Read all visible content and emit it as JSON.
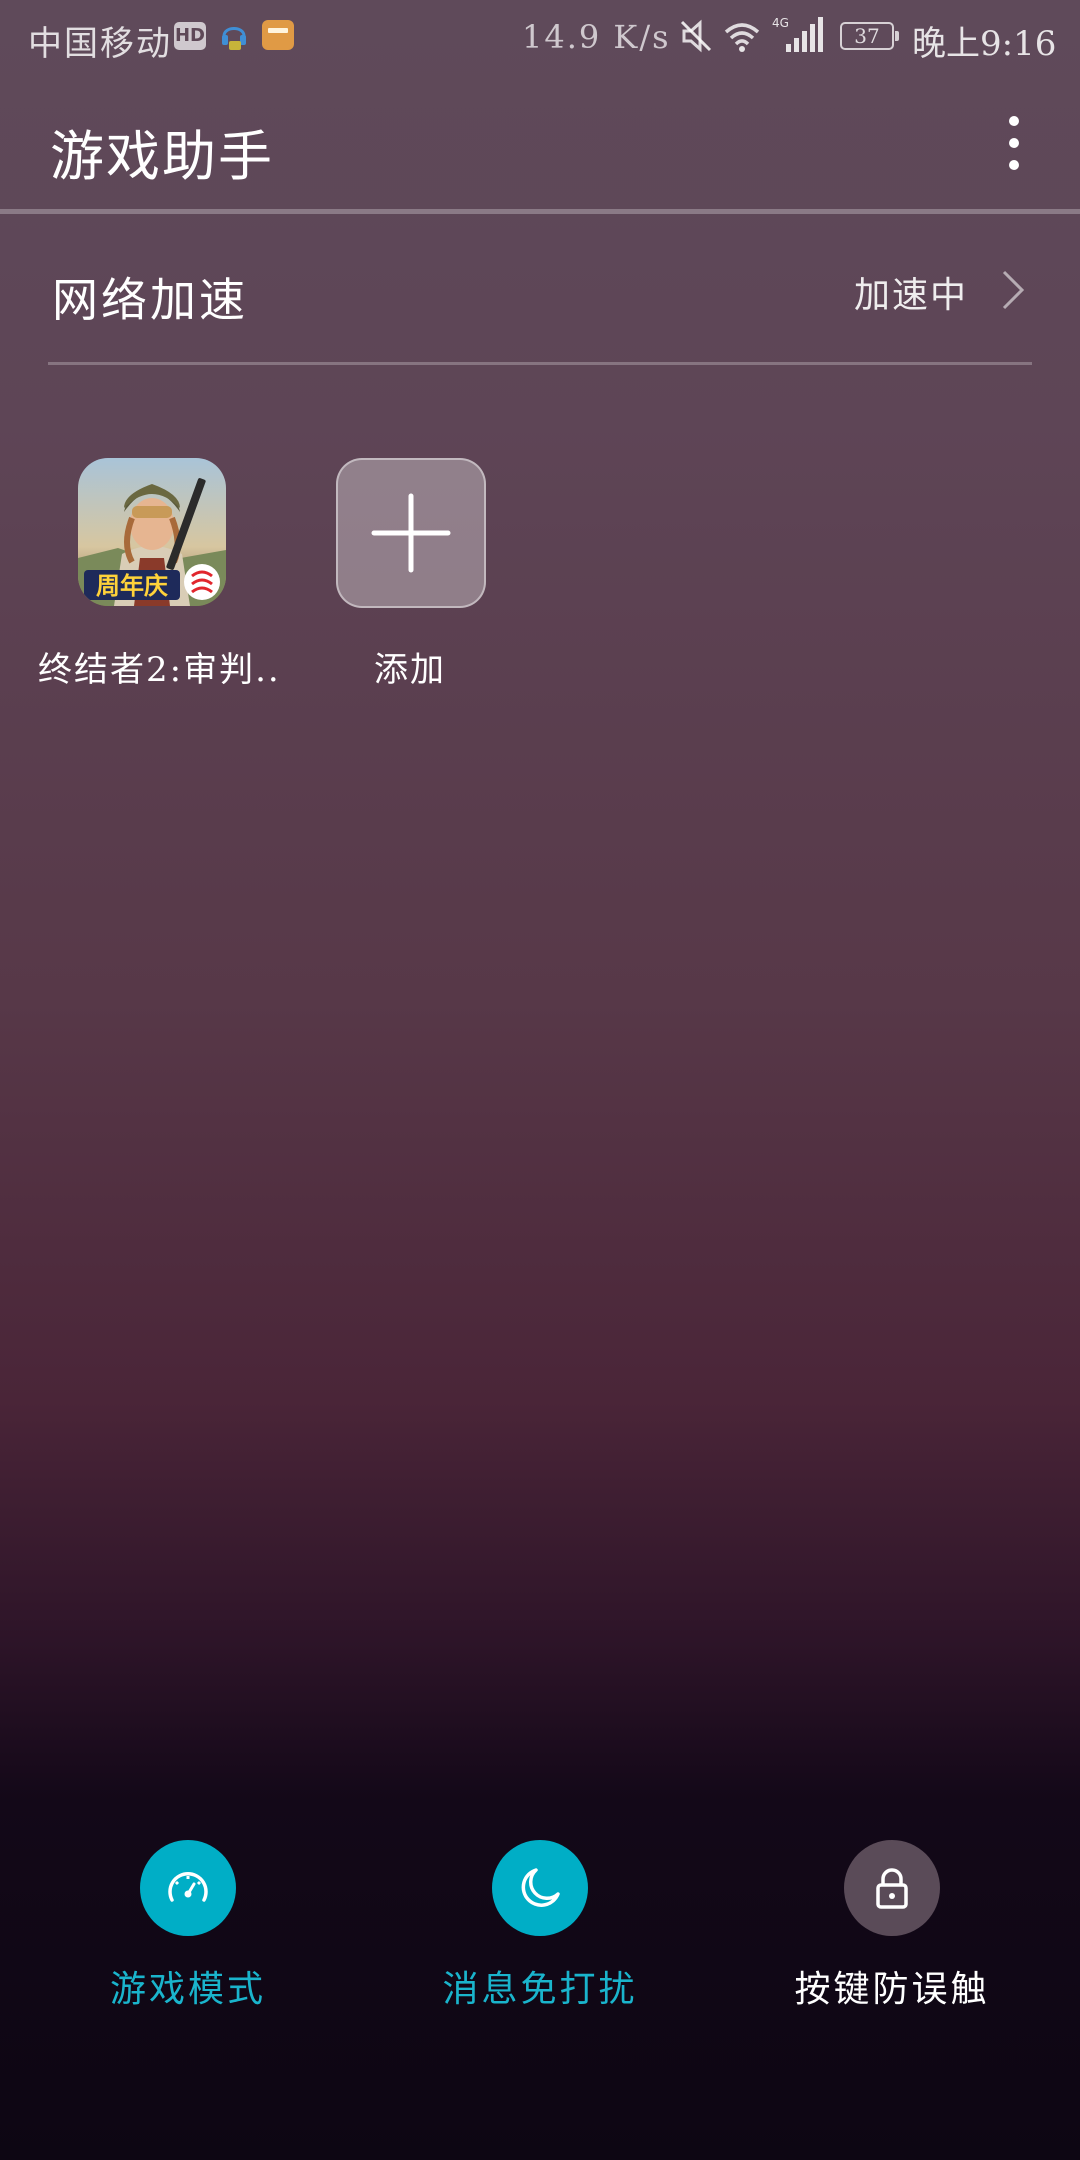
{
  "status_bar": {
    "carrier": "中国移动",
    "hd_badge": "HD",
    "net_speed": "14.9 K/s",
    "network_type": "4G",
    "battery": "37",
    "time": "晚上9:16"
  },
  "app_bar": {
    "title": "游戏助手"
  },
  "network_acceleration": {
    "label": "网络加速",
    "status": "加速中"
  },
  "games": [
    {
      "label": "终结者2:审判..",
      "icon": "game-app-icon",
      "badge_text": "周年庆"
    },
    {
      "label": "添加",
      "icon": "plus-icon"
    }
  ],
  "toggles": [
    {
      "label": "游戏模式",
      "icon": "speedometer-icon",
      "active": true
    },
    {
      "label": "消息免打扰",
      "icon": "moon-icon",
      "active": true
    },
    {
      "label": "按键防误触",
      "icon": "lock-icon",
      "active": false
    }
  ],
  "colors": {
    "accent": "#00aec6",
    "accent_text": "#1ab4cc",
    "inactive_circle": "#5a4b58"
  }
}
